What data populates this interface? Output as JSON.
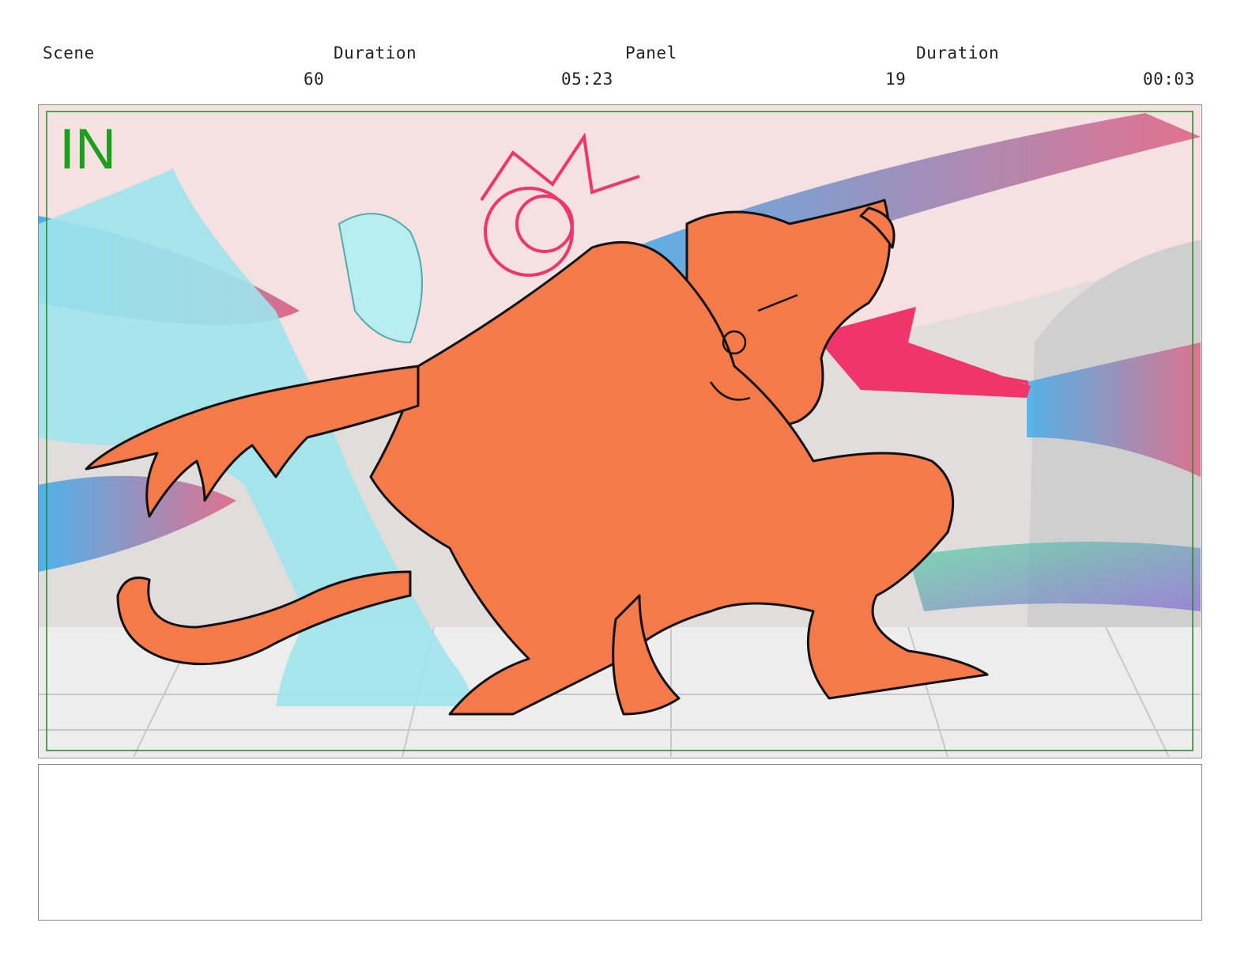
{
  "header": {
    "scene_label": "Scene",
    "scene_duration_label": "Duration",
    "panel_label": "Panel",
    "panel_duration_label": "Duration",
    "scene_value": "60",
    "scene_duration_value": "05:23",
    "panel_value": "19",
    "panel_duration_value": "00:03"
  },
  "panel": {
    "transition_label": "IN",
    "colors": {
      "safe_frame": "#1f8a1f",
      "in_label": "#1aa01a",
      "figure_fill": "#f47a4a",
      "ghost_figure": "#9fe4ec",
      "accent_pink": "#f0356a",
      "sky": "#f5e0e2"
    }
  },
  "notes": {
    "text": ""
  }
}
